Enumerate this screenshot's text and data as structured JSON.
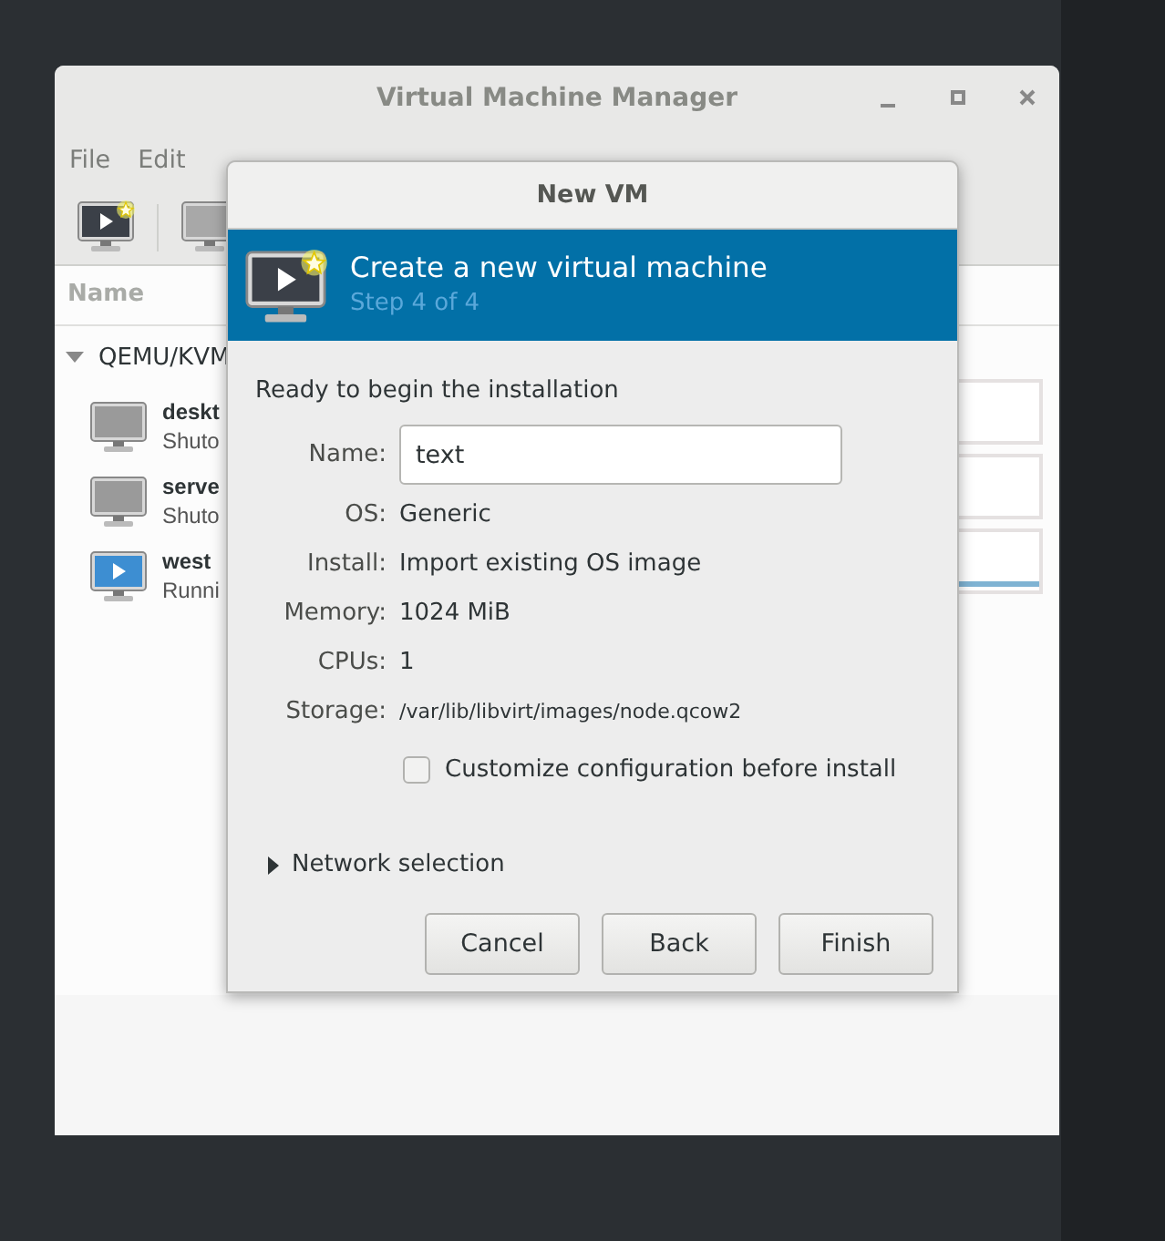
{
  "window": {
    "title": "Virtual Machine Manager"
  },
  "menu": [
    "File",
    "Edit"
  ],
  "vm_list": {
    "column": "Name",
    "group": {
      "label": "QEMU/KVM",
      "expanded": true,
      "vms": [
        {
          "name": "deskt",
          "status": "Shuto",
          "kind": "shutoff"
        },
        {
          "name": "serve",
          "status": "Shuto",
          "kind": "shutoff"
        },
        {
          "name": "west",
          "status": "Runni",
          "kind": "running"
        }
      ]
    }
  },
  "dialog": {
    "title": "New VM",
    "header": {
      "title": "Create a new virtual machine",
      "step": "Step 4 of 4"
    },
    "intro": "Ready to begin the installation",
    "fields": [
      {
        "label": "Name:",
        "kind": "input",
        "value": "text"
      },
      {
        "label": "OS:",
        "kind": "text",
        "value": "Generic"
      },
      {
        "label": "Install:",
        "kind": "text",
        "value": "Import existing OS image"
      },
      {
        "label": "Memory:",
        "kind": "text",
        "value": "1024 MiB"
      },
      {
        "label": "CPUs:",
        "kind": "text",
        "value": "1"
      },
      {
        "label": "Storage:",
        "kind": "path",
        "value": "/var/lib/libvirt/images/node.qcow2"
      }
    ],
    "checkbox": {
      "label": "Customize configuration before install",
      "checked": false
    },
    "expander": {
      "label": "Network selection",
      "expanded": false
    },
    "buttons": [
      "Cancel",
      "Back",
      "Finish"
    ]
  }
}
